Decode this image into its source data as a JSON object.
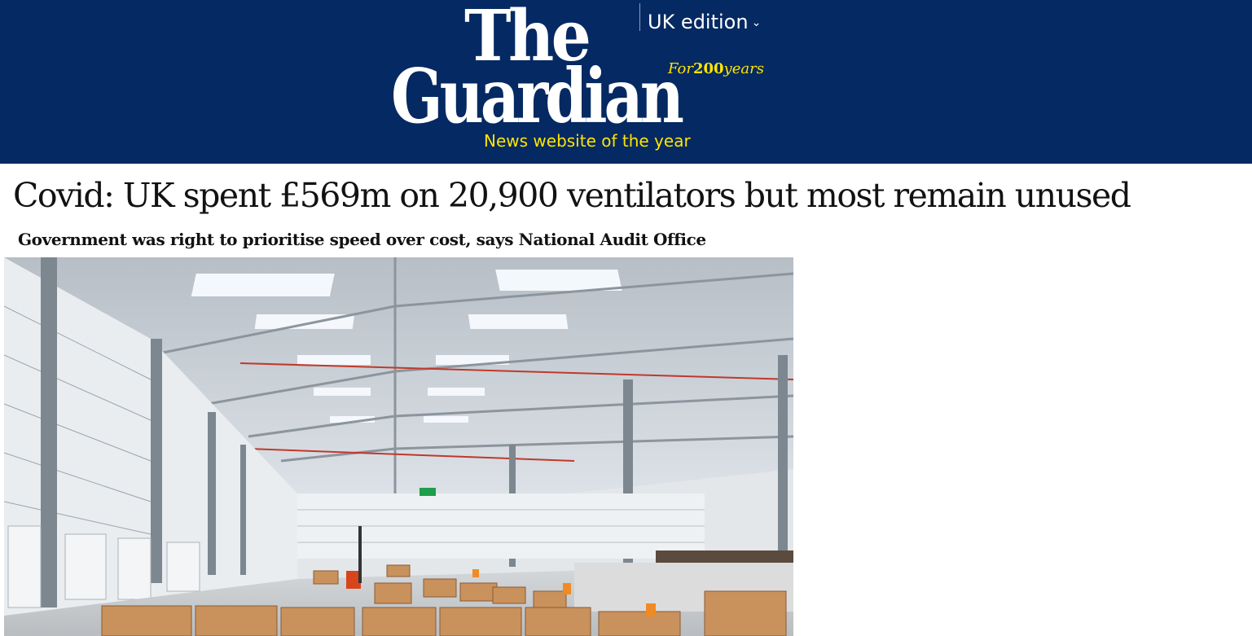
{
  "masthead": {
    "logo_line1": "The",
    "logo_line2": "Guardian",
    "anniversary_prefix": "For",
    "anniversary_number": "200",
    "anniversary_suffix": "years",
    "tagline": "News website of the year",
    "edition_label": "UK edition",
    "edition_chevron": "⌄",
    "background_color": "#052962",
    "accent_color": "#ffe500"
  },
  "article": {
    "headline": "Covid: UK spent £569m on 20,900  ventilators but most remain unused",
    "standfirst": "Government was right to prioritise speed over cost, says National  Audit Office",
    "image": {
      "icon": "warehouse-photo",
      "subject": "warehouse"
    }
  }
}
